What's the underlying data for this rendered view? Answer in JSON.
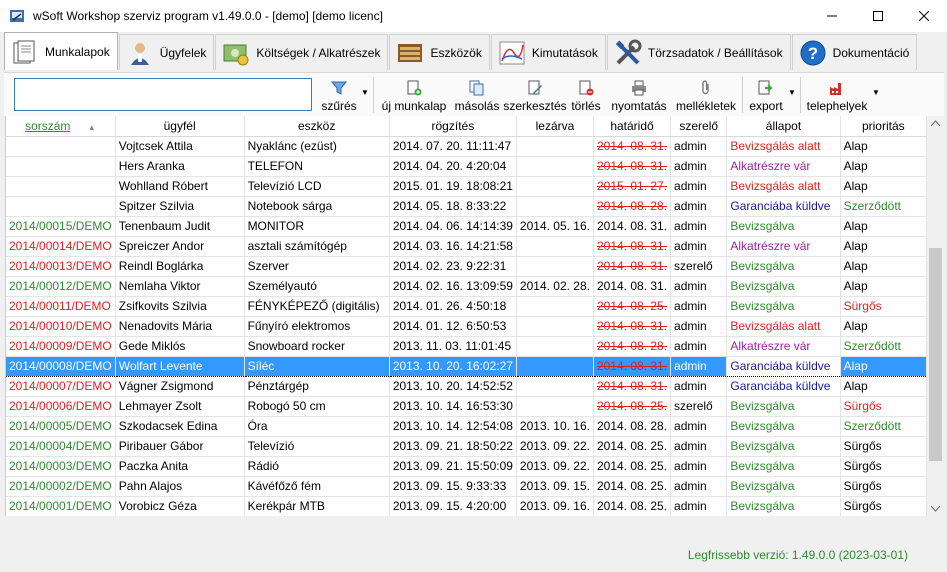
{
  "window": {
    "title": "wSoft Workshop szerviz program v1.49.0.0 - [demo] [demo licenc]"
  },
  "tabs": [
    {
      "label": "Munkalapok",
      "icon": "worksheets-icon"
    },
    {
      "label": "Ügyfelek",
      "icon": "customer-icon"
    },
    {
      "label": "Költségek / Alkatrészek",
      "icon": "costs-icon"
    },
    {
      "label": "Eszközök",
      "icon": "devices-icon"
    },
    {
      "label": "Kimutatások",
      "icon": "chart-icon"
    },
    {
      "label": "Törzsadatok / Beállítások",
      "icon": "tools-icon"
    },
    {
      "label": "Dokumentáció",
      "icon": "help-icon"
    }
  ],
  "toolbar": {
    "search_value": "",
    "filter": "szűrés",
    "new": "új munkalap",
    "copy": "másolás",
    "edit": "szerkesztés",
    "delete": "törlés",
    "print": "nyomtatás",
    "attachments": "mellékletek",
    "export": "export",
    "sites": "telephelyek"
  },
  "table": {
    "columns": [
      "sorszám",
      "ügyfél",
      "eszköz",
      "rögzítés",
      "lezárva",
      "határidő",
      "szerelő",
      "állapot",
      "prioritás"
    ],
    "sort_indicator": "▲",
    "rows": [
      {
        "id": "",
        "client": "Vojtcsek Attila",
        "device": "Nyaklánc (ezüst)",
        "recorded": "2014. 07. 20. 11:11:47",
        "closed": "",
        "deadline": "2014. 08. 31.",
        "tech": "admin",
        "status": "Bevizsgálás alatt",
        "priority": "Alap",
        "id_color": "#000000",
        "status_color": "#e02020",
        "priority_color": "#000000",
        "deadline_strike": true
      },
      {
        "id": "",
        "client": "Hers Aranka",
        "device": "TELEFON",
        "recorded": "2014. 04. 20. 4:20:04",
        "closed": "",
        "deadline": "2014. 08. 31.",
        "tech": "admin",
        "status": "Alkatrészre vár",
        "priority": "Alap",
        "id_color": "#000000",
        "status_color": "#a020a0",
        "priority_color": "#000000",
        "deadline_strike": true
      },
      {
        "id": "",
        "client": "Wohlland Róbert",
        "device": "Televízió LCD",
        "recorded": "2015. 01. 19. 18:08:21",
        "closed": "",
        "deadline": "2015. 01. 27.",
        "tech": "admin",
        "status": "Bevizsgálás alatt",
        "priority": "Alap",
        "id_color": "#000000",
        "status_color": "#e02020",
        "priority_color": "#000000",
        "deadline_strike": true
      },
      {
        "id": "",
        "client": "Spitzer Szilvia",
        "device": "Notebook sárga",
        "recorded": "2014. 05. 18. 8:33:22",
        "closed": "",
        "deadline": "2014. 08. 28.",
        "tech": "admin",
        "status": "Garanciába küldve",
        "priority": "Szerződött",
        "id_color": "#000000",
        "status_color": "#1a1aa0",
        "priority_color": "#2e8b2e",
        "deadline_strike": true
      },
      {
        "id": "2014/00015/DEMO",
        "client": "Tenenbaum Judit",
        "device": "MONITOR",
        "recorded": "2014. 04. 06. 14:14:39",
        "closed": "2014. 05. 16.",
        "deadline": "2014. 08. 31.",
        "tech": "admin",
        "status": "Bevizsgálva",
        "priority": "Alap",
        "id_color": "#2e8b2e",
        "status_color": "#2e8b2e",
        "priority_color": "#000000",
        "deadline_strike": false
      },
      {
        "id": "2014/00014/DEMO",
        "client": "Spreiczer Andor",
        "device": "asztali számítógép",
        "recorded": "2014. 03. 16. 14:21:58",
        "closed": "",
        "deadline": "2014. 08. 31.",
        "tech": "admin",
        "status": "Alkatrészre vár",
        "priority": "Alap",
        "id_color": "#e02020",
        "status_color": "#a020a0",
        "priority_color": "#000000",
        "deadline_strike": true
      },
      {
        "id": "2014/00013/DEMO",
        "client": "Reindl Boglárka",
        "device": "Szerver",
        "recorded": "2014. 02. 23. 9:22:31",
        "closed": "",
        "deadline": "2014. 08. 31.",
        "tech": "szerelő",
        "status": "Bevizsgálva",
        "priority": "Alap",
        "id_color": "#e02020",
        "status_color": "#2e8b2e",
        "priority_color": "#000000",
        "deadline_strike": true
      },
      {
        "id": "2014/00012/DEMO",
        "client": "Nemlaha Viktor",
        "device": "Személyautó",
        "recorded": "2014. 02. 16. 13:09:59",
        "closed": "2014. 02. 28.",
        "deadline": "2014. 08. 31.",
        "tech": "admin",
        "status": "Bevizsgálva",
        "priority": "Alap",
        "id_color": "#2e8b2e",
        "status_color": "#2e8b2e",
        "priority_color": "#000000",
        "deadline_strike": false
      },
      {
        "id": "2014/00011/DEMO",
        "client": "Zsifkovits Szilvia",
        "device": "FÉNYKÉPEZŐ (digitális)",
        "recorded": "2014. 01. 26. 4:50:18",
        "closed": "",
        "deadline": "2014. 08. 25.",
        "tech": "admin",
        "status": "Bevizsgálva",
        "priority": "Sürgős",
        "id_color": "#e02020",
        "status_color": "#2e8b2e",
        "priority_color": "#e02020",
        "deadline_strike": true
      },
      {
        "id": "2014/00010/DEMO",
        "client": "Nenadovits Mária",
        "device": "Fűnyíró elektromos",
        "recorded": "2014. 01. 12. 6:50:53",
        "closed": "",
        "deadline": "2014. 08. 31.",
        "tech": "admin",
        "status": "Bevizsgálás alatt",
        "priority": "Alap",
        "id_color": "#e02020",
        "status_color": "#e02020",
        "priority_color": "#000000",
        "deadline_strike": true
      },
      {
        "id": "2014/00009/DEMO",
        "client": "Gede Miklós",
        "device": "Snowboard rocker",
        "recorded": "2013. 11. 03. 11:01:45",
        "closed": "",
        "deadline": "2014. 08. 28.",
        "tech": "admin",
        "status": "Alkatrészre vár",
        "priority": "Szerződött",
        "id_color": "#e02020",
        "status_color": "#a020a0",
        "priority_color": "#2e8b2e",
        "deadline_strike": true
      },
      {
        "id": "2014/00008/DEMO",
        "client": "Wolfart Levente",
        "device": "Síléc",
        "recorded": "2013. 10. 20. 16:02:27",
        "closed": "",
        "deadline": "2014. 08. 31.",
        "tech": "admin",
        "status": "Garanciába küldve",
        "priority": "Alap",
        "id_color": "#e02020",
        "status_color": "#1a1aa0",
        "priority_color": "#000000",
        "deadline_strike": true,
        "selected": true
      },
      {
        "id": "2014/00007/DEMO",
        "client": "Vágner Zsigmond",
        "device": "Pénztárgép",
        "recorded": "2013. 10. 20. 14:52:52",
        "closed": "",
        "deadline": "2014. 08. 31.",
        "tech": "admin",
        "status": "Garanciába küldve",
        "priority": "Alap",
        "id_color": "#e02020",
        "status_color": "#1a1aa0",
        "priority_color": "#000000",
        "deadline_strike": true
      },
      {
        "id": "2014/00006/DEMO",
        "client": "Lehmayer Zsolt",
        "device": "Robogó 50 cm",
        "recorded": "2013. 10. 14. 16:53:30",
        "closed": "",
        "deadline": "2014. 08. 25.",
        "tech": "szerelő",
        "status": "Bevizsgálva",
        "priority": "Sürgős",
        "id_color": "#e02020",
        "status_color": "#2e8b2e",
        "priority_color": "#e02020",
        "deadline_strike": true
      },
      {
        "id": "2014/00005/DEMO",
        "client": "Szkodacsek Edina",
        "device": "Óra",
        "recorded": "2013. 10. 14. 12:54:08",
        "closed": "2013. 10. 16.",
        "deadline": "2014. 08. 28.",
        "tech": "admin",
        "status": "Bevizsgálva",
        "priority": "Szerződött",
        "id_color": "#2e8b2e",
        "status_color": "#2e8b2e",
        "priority_color": "#2e8b2e",
        "deadline_strike": false
      },
      {
        "id": "2014/00004/DEMO",
        "client": "Piribauer Gábor",
        "device": "Televízió",
        "recorded": "2013. 09. 21. 18:50:22",
        "closed": "2013. 09. 22.",
        "deadline": "2014. 08. 25.",
        "tech": "admin",
        "status": "Bevizsgálva",
        "priority": "Sürgős",
        "id_color": "#2e8b2e",
        "status_color": "#2e8b2e",
        "priority_color": "#000000",
        "deadline_strike": false
      },
      {
        "id": "2014/00003/DEMO",
        "client": "Paczka Anita",
        "device": "Rádió",
        "recorded": "2013. 09. 21. 15:50:09",
        "closed": "2013. 09. 22.",
        "deadline": "2014. 08. 25.",
        "tech": "admin",
        "status": "Bevizsgálva",
        "priority": "Sürgős",
        "id_color": "#2e8b2e",
        "status_color": "#2e8b2e",
        "priority_color": "#000000",
        "deadline_strike": false
      },
      {
        "id": "2014/00002/DEMO",
        "client": "Pahn Alajos",
        "device": "Kávéfőző fém",
        "recorded": "2013. 09. 15. 9:33:33",
        "closed": "2013. 09. 15.",
        "deadline": "2014. 08. 25.",
        "tech": "admin",
        "status": "Bevizsgálva",
        "priority": "Sürgős",
        "id_color": "#2e8b2e",
        "status_color": "#2e8b2e",
        "priority_color": "#000000",
        "deadline_strike": false
      },
      {
        "id": "2014/00001/DEMO",
        "client": "Vorobicz Géza",
        "device": "Kerékpár MTB",
        "recorded": "2013. 09. 15. 4:20:00",
        "closed": "2013. 09. 16.",
        "deadline": "2014. 08. 25.",
        "tech": "admin",
        "status": "Bevizsgálva",
        "priority": "Sürgős",
        "id_color": "#2e8b2e",
        "status_color": "#2e8b2e",
        "priority_color": "#000000",
        "deadline_strike": false
      }
    ]
  },
  "statusbar": {
    "version": "Legfrissebb verzió: 1.49.0.0 (2023-03-01)"
  }
}
